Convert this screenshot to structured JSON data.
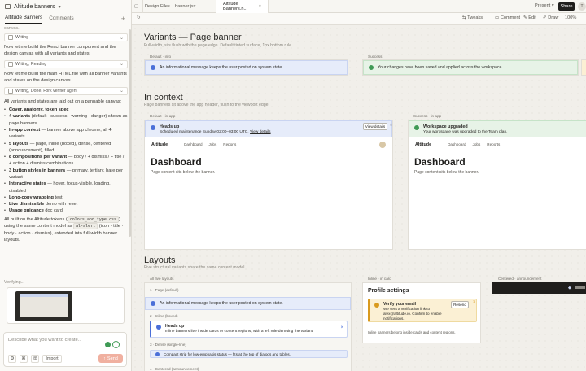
{
  "app": {
    "title": "Altitude banners"
  },
  "left_tabs": [
    "Altitude Banners",
    "Comments"
  ],
  "chat": {
    "cut_top": "canvas.",
    "steps": [
      "Writing",
      "Writing, Reading",
      "Writing, Done, Fork verifier agent"
    ],
    "msg1": "Now let me build the React banner component and the design canvas with all variants and states.",
    "msg2": "Now let me build the main HTML file with all banner variants and states on the design canvas.",
    "intro": "All variants and states are laid out on a pannable canvas:",
    "bullets": [
      {
        "b": "Cover, anatomy, token spec",
        "t": ""
      },
      {
        "b": "4 variants",
        "t": " (default · success · warning · danger) shown as page banners"
      },
      {
        "b": "In-app context",
        "t": " — banner above app chrome, all 4 variants"
      },
      {
        "b": "5 layouts",
        "t": " — page, inline (boxed), dense, centered (announcement), filled"
      },
      {
        "b": "8 compositions per variant",
        "t": " — body / + dismiss / + title / + action + dismiss combinations"
      },
      {
        "b": "3 button styles in banners",
        "t": " — primary, tertiary, bare per variant"
      },
      {
        "b": "Interactive states",
        "t": " — hover, focus-visible, loading, disabled"
      },
      {
        "b": "Long-copy wrapping",
        "t": " test"
      },
      {
        "b": "Live dismissible",
        "t": " demo with reset"
      },
      {
        "b": "Usage guidance",
        "t": " doc card"
      }
    ],
    "outro_a": "All built on the Altitude tokens (",
    "outro_code1": "colors_and_type.css",
    "outro_b": ") using the same content model as ",
    "outro_code2": "al-alert",
    "outro_c": " (icon · title · body · action · dismiss), extended into full-width banner layouts.",
    "verifying": "Verifying..."
  },
  "composer": {
    "placeholder": "Describe what you want to create...",
    "import": "Import",
    "send": "Send"
  },
  "file_tabs": [
    "Design Files",
    "banner.jsx",
    "Altitude Banners.h..."
  ],
  "top": {
    "present": "Present",
    "share": "Share",
    "avatar": "T"
  },
  "toolbar": {
    "tweaks": "Tweaks",
    "comment": "Comment",
    "edit": "Edit",
    "draw": "Draw",
    "zoom": "100%"
  },
  "canvas": {
    "s1_title": "Variants — Page banner",
    "s1_sub": "Full-width, sits flush with the page edge. Default tinted surface, 1px bottom rule.",
    "s1_labels": [
      "Default · info",
      "Success"
    ],
    "info_msg": "An informational message keeps the user posted on system state.",
    "success_msg": "Your changes have been saved and applied across the workspace.",
    "s2_title": "In context",
    "s2_sub": "Page banners sit above the app header, flush to the viewport edge.",
    "s2_labels": [
      "Default · in-app",
      "Success · in-app"
    ],
    "ctx_info_title": "Heads up",
    "ctx_info_body": "Scheduled maintenance Sunday 02:00–03:00 UTC.",
    "ctx_info_link": "View details",
    "ctx_info_btn": "View details",
    "ctx_ok_title": "Workspace upgraded",
    "ctx_ok_body": "Your workspace was upgraded to the Team plan.",
    "nav_logo": "Altitude",
    "nav_items": [
      "Dashboard",
      "Jobs",
      "Reports"
    ],
    "dash": "Dashboard",
    "page_content": "Page content sits below the banner.",
    "s3_title": "Layouts",
    "s3_sub": "Five structural variants share the same content model.",
    "s3_labels": [
      "All five layouts",
      "Inline · in card",
      "Centered · announcement"
    ],
    "rows": [
      "1 · Page (default)",
      "2 · Inline (boxed)",
      "3 · Dense (single-line)",
      "4 · Centered (announcement)"
    ],
    "inline_title": "Heads up",
    "inline_body": "Inline banners live inside cards or content regions, with a left rule denoting the variant.",
    "dense_msg": "Compact strip for low-emphasis status — fits at the top of dialogs and tables.",
    "profile_title": "Profile settings",
    "verify_title": "Verify your email",
    "verify_body": "We sent a verification link to alex@altitude.io. Confirm to enable notifications.",
    "resend": "Resend",
    "inline_note": "Inline banners belong inside cards and content regions."
  },
  "colors": {
    "info": "#4a6fd8",
    "success": "#3f9a55",
    "warning": "#d99a1e",
    "accent": "#f0b0a0"
  }
}
